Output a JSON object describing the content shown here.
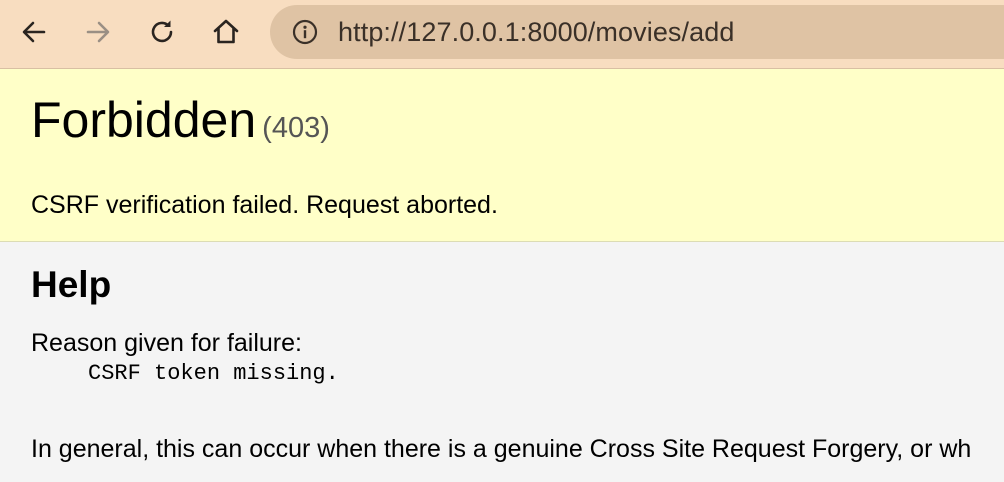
{
  "browser": {
    "url": "http://127.0.0.1:8000/movies/add",
    "icons": {
      "back": "arrow-left-icon",
      "forward": "arrow-right-icon",
      "reload": "reload-icon",
      "home": "home-icon",
      "site_info": "info-icon"
    },
    "colors": {
      "toolbar": "#f8ddc0",
      "address_bar": "#dfc3a4"
    }
  },
  "summary": {
    "title": "Forbidden",
    "status_code": "(403)",
    "message": "CSRF verification failed. Request aborted.",
    "background": "#ffffc8"
  },
  "info": {
    "heading": "Help",
    "reason_label": "Reason given for failure:",
    "reason_value": "CSRF token missing.",
    "general_text": "In general, this can occur when there is a genuine Cross Site Request Forgery, or wh"
  }
}
